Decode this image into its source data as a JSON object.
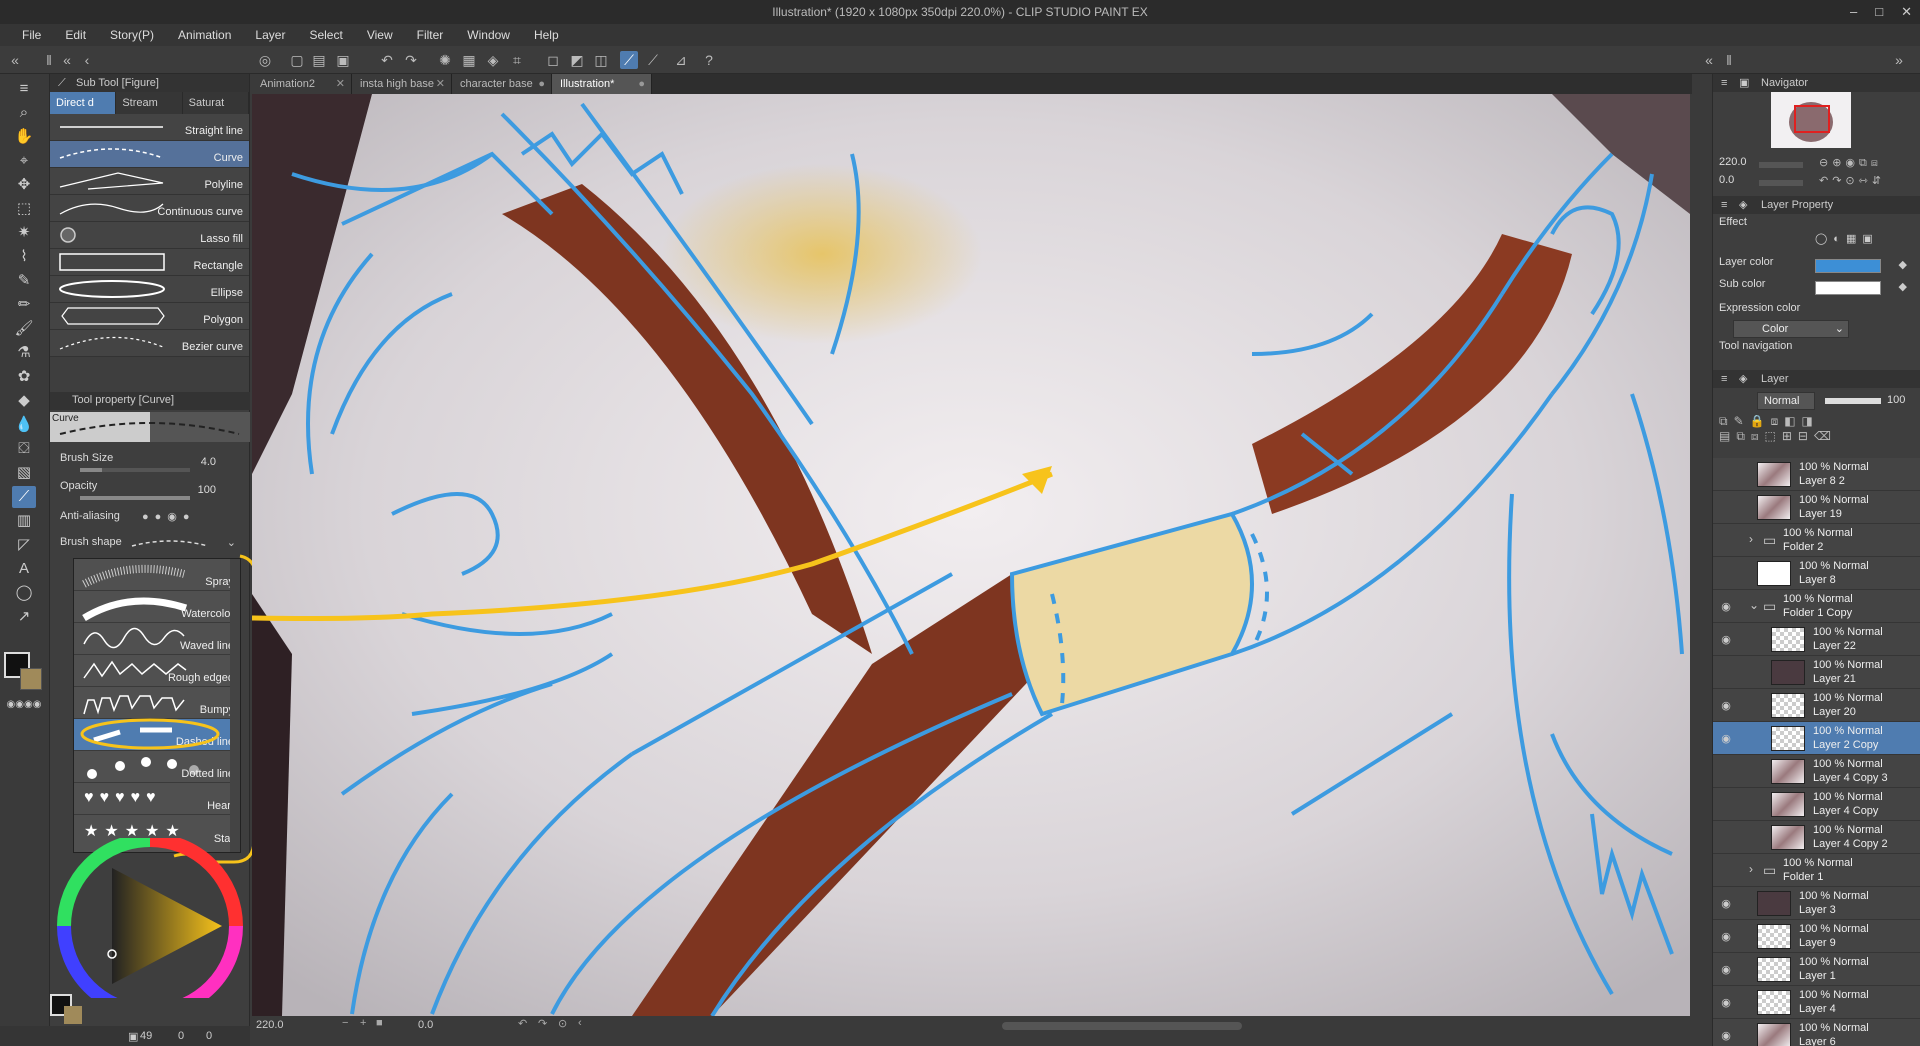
{
  "window": {
    "title": "Illustration* (1920 x 1080px 350dpi 220.0%)  - CLIP STUDIO PAINT EX"
  },
  "menu": [
    "File",
    "Edit",
    "Story(P)",
    "Animation",
    "Layer",
    "Select",
    "View",
    "Filter",
    "Window",
    "Help"
  ],
  "subtool_panel": {
    "title": "Sub Tool [Figure]",
    "tabs": [
      "Direct d",
      "Stream",
      "Saturat"
    ],
    "items": [
      "Straight line",
      "Curve",
      "Polyline",
      "Continuous curve",
      "Lasso fill",
      "Rectangle",
      "Ellipse",
      "Polygon",
      "Bezier curve"
    ],
    "active_item": "Curve"
  },
  "tool_property": {
    "title": "Tool property [Curve]",
    "preview_label": "Curve",
    "brush_size_label": "Brush Size",
    "brush_size_value": "4.0",
    "opacity_label": "Opacity",
    "opacity_value": "100",
    "anti_aliasing_label": "Anti-aliasing",
    "brush_shape_label": "Brush shape"
  },
  "brush_shapes": [
    "Spray",
    "Watercolor",
    "Waved line",
    "Rough edged",
    "Bumpy",
    "Dashed line",
    "Dotted line",
    "Heart",
    "Star"
  ],
  "active_brush_shape": "Dashed line",
  "doc_tabs": [
    {
      "label": "Animation2",
      "active": false
    },
    {
      "label": "insta high base",
      "active": false
    },
    {
      "label": "character base",
      "active": false
    },
    {
      "label": "Illustration*",
      "active": true
    }
  ],
  "status": {
    "zoom": "220.0",
    "rotation": "0.0",
    "left_count": "49",
    "left_zero1": "0",
    "left_zero2": "0"
  },
  "navigator": {
    "title": "Navigator",
    "zoom": "220.0",
    "rotation": "0.0"
  },
  "layer_property": {
    "title": "Layer Property",
    "effect_label": "Effect",
    "layer_color_label": "Layer color",
    "layer_color": "#3d8fd6",
    "sub_color_label": "Sub color",
    "sub_color": "#ffffff",
    "expression_color_label": "Expression color",
    "expression_color_value": "Color",
    "tool_navigation_label": "Tool navigation"
  },
  "layer_panel": {
    "title": "Layer",
    "blend_mode": "Normal",
    "opacity": "100",
    "layers": [
      {
        "mode": "100 % Normal",
        "name": "Layer 8 2",
        "indent": 0,
        "type": "art",
        "eye": false
      },
      {
        "mode": "100 % Normal",
        "name": "Layer 19",
        "indent": 0,
        "type": "art",
        "eye": false
      },
      {
        "mode": "100 % Normal",
        "name": "Folder 2",
        "indent": 0,
        "type": "folder",
        "eye": false
      },
      {
        "mode": "100 % Normal",
        "name": "Layer 8",
        "indent": 0,
        "type": "white",
        "eye": false
      },
      {
        "mode": "100 % Normal",
        "name": "Folder 1 Copy",
        "indent": 0,
        "type": "folder-open",
        "eye": true
      },
      {
        "mode": "100 % Normal",
        "name": "Layer 22",
        "indent": 1,
        "type": "checker",
        "eye": true
      },
      {
        "mode": "100 % Normal",
        "name": "Layer 21",
        "indent": 1,
        "type": "dark",
        "eye": false
      },
      {
        "mode": "100 % Normal",
        "name": "Layer 20",
        "indent": 1,
        "type": "checker",
        "eye": true
      },
      {
        "mode": "100 % Normal",
        "name": "Layer 2 Copy",
        "indent": 1,
        "type": "checker",
        "eye": true,
        "selected": true
      },
      {
        "mode": "100 % Normal",
        "name": "Layer 4 Copy 3",
        "indent": 1,
        "type": "art",
        "eye": false
      },
      {
        "mode": "100 % Normal",
        "name": "Layer 4 Copy",
        "indent": 1,
        "type": "art",
        "eye": false
      },
      {
        "mode": "100 % Normal",
        "name": "Layer 4 Copy 2",
        "indent": 1,
        "type": "art",
        "eye": false
      },
      {
        "mode": "100 % Normal",
        "name": "Folder 1",
        "indent": 0,
        "type": "folder",
        "eye": false
      },
      {
        "mode": "100 % Normal",
        "name": "Layer 3",
        "indent": 0,
        "type": "dark",
        "eye": true
      },
      {
        "mode": "100 % Normal",
        "name": "Layer 9",
        "indent": 0,
        "type": "checker",
        "eye": true
      },
      {
        "mode": "100 % Normal",
        "name": "Layer 1",
        "indent": 0,
        "type": "checker",
        "eye": true
      },
      {
        "mode": "100 % Normal",
        "name": "Layer 4",
        "indent": 0,
        "type": "checker",
        "eye": true
      },
      {
        "mode": "100 % Normal",
        "name": "Layer 6",
        "indent": 0,
        "type": "art",
        "eye": true
      }
    ]
  },
  "icons": {
    "eye": "👁",
    "folder": "▭",
    "chevron_right": "›",
    "chevron_down": "⌄"
  },
  "colors": {
    "accent": "#4f7cb0",
    "highlight": "#f7c31b",
    "lineart": "#3d9be0",
    "strap": "#8b3a22"
  }
}
